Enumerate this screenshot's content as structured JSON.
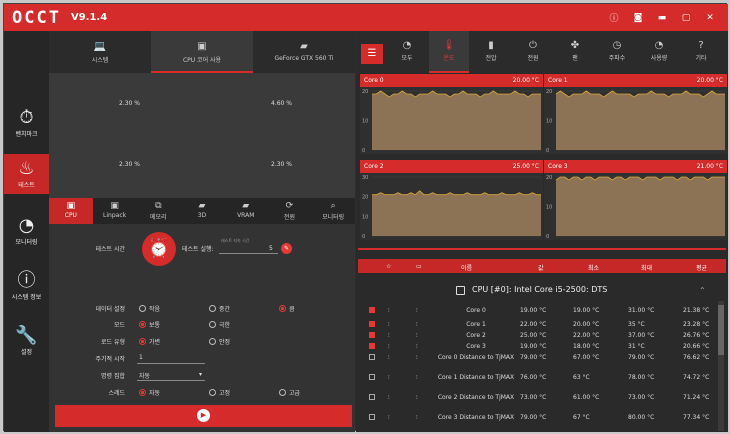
{
  "app": {
    "logo": "OCCT",
    "version": "V9.1.4"
  },
  "titlebar_icons": [
    "info-icon",
    "camera-icon",
    "minimize-icon",
    "maximize-icon",
    "close-icon"
  ],
  "sidebar": {
    "items": [
      {
        "label": "벤치마크",
        "icon": "stopwatch-icon"
      },
      {
        "label": "테스트",
        "icon": "flame-icon"
      },
      {
        "label": "모니터링",
        "icon": "gauge-icon"
      },
      {
        "label": "시스템 정보",
        "icon": "info-icon"
      },
      {
        "label": "설정",
        "icon": "wrench-icon"
      }
    ]
  },
  "top_tabs": [
    {
      "label": "시스템"
    },
    {
      "label": "CPU 코어 사용"
    },
    {
      "label": "GeForce GTX 560 Ti"
    }
  ],
  "core_usage": [
    "2.30 %",
    "4.60 %",
    "2.30 %",
    "2.30 %"
  ],
  "sub_tabs": [
    {
      "label": "CPU"
    },
    {
      "label": "Linpack"
    },
    {
      "label": "메모리"
    },
    {
      "label": "3D"
    },
    {
      "label": "VRAM"
    },
    {
      "label": "전원"
    },
    {
      "label": "모니터링"
    }
  ],
  "settings": {
    "test_time_label": "테스트 시간",
    "test_run_label": "테스트 실행:",
    "test_run_hint": "테스트 지속 시간",
    "test_run_value": "5",
    "data_size": {
      "label": "데이터 설정",
      "options": [
        "작음",
        "중간",
        "큼"
      ]
    },
    "mode": {
      "label": "모드",
      "options": [
        "보통",
        "극한"
      ]
    },
    "load_type": {
      "label": "로드 유형",
      "options": [
        "가변",
        "안정"
      ]
    },
    "cycle_start": {
      "label": "주기적 시작",
      "value": "1"
    },
    "instruction_set": {
      "label": "명령 집합",
      "value": "자동"
    },
    "threads": {
      "label": "스레드",
      "options": [
        "자동",
        "고정",
        "고급"
      ]
    }
  },
  "right_tabs": [
    {
      "label": "모두"
    },
    {
      "label": "온도"
    },
    {
      "label": "전압"
    },
    {
      "label": "전원"
    },
    {
      "label": "팬"
    },
    {
      "label": "주파수"
    },
    {
      "label": "사용량"
    },
    {
      "label": "기타"
    }
  ],
  "charts": [
    {
      "name": "Core 0",
      "temp": "20.00 °C",
      "y_ticks": [
        "20",
        "10",
        "0"
      ],
      "values": [
        19,
        19,
        20,
        19,
        18,
        19,
        19,
        20,
        19,
        19,
        18,
        19,
        19,
        19,
        20,
        19,
        19,
        19,
        18,
        19,
        19,
        20,
        19,
        19,
        19,
        18,
        19,
        19,
        20,
        19,
        19,
        19,
        19,
        20,
        19,
        19,
        18,
        19,
        19,
        19
      ]
    },
    {
      "name": "Core 1",
      "temp": "20.00 °C",
      "y_ticks": [
        "20",
        "10",
        "0"
      ],
      "values": [
        19,
        20,
        19,
        18,
        19,
        19,
        19,
        20,
        19,
        19,
        19,
        18,
        19,
        20,
        19,
        19,
        19,
        19,
        18,
        19,
        19,
        19,
        20,
        19,
        19,
        19,
        18,
        19,
        19,
        19,
        20,
        19,
        19,
        19,
        18,
        19,
        20,
        19,
        19,
        19
      ]
    },
    {
      "name": "Core 2",
      "temp": "25.00 °C",
      "y_ticks": [
        "30",
        "20",
        "10",
        "0"
      ],
      "values": [
        21,
        21,
        22,
        21,
        21,
        21,
        22,
        21,
        21,
        22,
        21,
        23,
        21,
        21,
        22,
        21,
        21,
        21,
        22,
        21,
        21,
        21,
        22,
        21,
        21,
        21,
        22,
        21,
        21,
        21,
        22,
        21,
        21,
        21,
        22,
        21,
        21,
        22,
        21,
        21
      ]
    },
    {
      "name": "Core 3",
      "temp": "21.00 °C",
      "y_ticks": [
        "20",
        "10",
        "0"
      ],
      "values": [
        19,
        20,
        20,
        19,
        20,
        20,
        19,
        20,
        20,
        19,
        20,
        20,
        20,
        19,
        20,
        20,
        19,
        20,
        20,
        20,
        19,
        20,
        20,
        20,
        19,
        20,
        20,
        20,
        19,
        20,
        20,
        19,
        20,
        20,
        20,
        19,
        20,
        20,
        20,
        20
      ]
    }
  ],
  "table": {
    "headers": [
      "이름",
      "값",
      "최소",
      "최대",
      "평균"
    ],
    "group_title": "CPU [#0]: Intel Core i5-2500: DTS",
    "rows": [
      {
        "name": "Core 0",
        "value": "19.00 °C",
        "min": "19.00 °C",
        "max": "31.00 °C",
        "avg": "21.38 °C",
        "checked": true
      },
      {
        "name": "Core 1",
        "value": "22.00 °C",
        "min": "20.00 °C",
        "max": "35 °C",
        "avg": "23.28 °C",
        "checked": true
      },
      {
        "name": "Core 2",
        "value": "25.00 °C",
        "min": "22.00 °C",
        "max": "37.00 °C",
        "avg": "26.76 °C",
        "checked": true
      },
      {
        "name": "Core 3",
        "value": "19.00 °C",
        "min": "18.00 °C",
        "max": "31 °C",
        "avg": "20.66 °C",
        "checked": true
      },
      {
        "name": "Core 0 Distance to TjMAX",
        "value": "79.00 °C",
        "min": "67.00 °C",
        "max": "79.00 °C",
        "avg": "76.62 °C",
        "checked": false
      },
      {
        "name": "Core 1 Distance to TjMAX",
        "value": "76.00 °C",
        "min": "63 °C",
        "max": "78.00 °C",
        "avg": "74.72 °C",
        "checked": false
      },
      {
        "name": "Core 2 Distance to TjMAX",
        "value": "73.00 °C",
        "min": "61.00 °C",
        "max": "73.00 °C",
        "avg": "71.24 °C",
        "checked": false
      },
      {
        "name": "Core 3 Distance to TjMAX",
        "value": "79.00 °C",
        "min": "67 °C",
        "max": "80.00 °C",
        "avg": "77.34 °C",
        "checked": false
      }
    ]
  },
  "colors": {
    "accent": "#d52b2b",
    "chart_fill": "#8c7356",
    "chart_line": "#e0a53a"
  }
}
